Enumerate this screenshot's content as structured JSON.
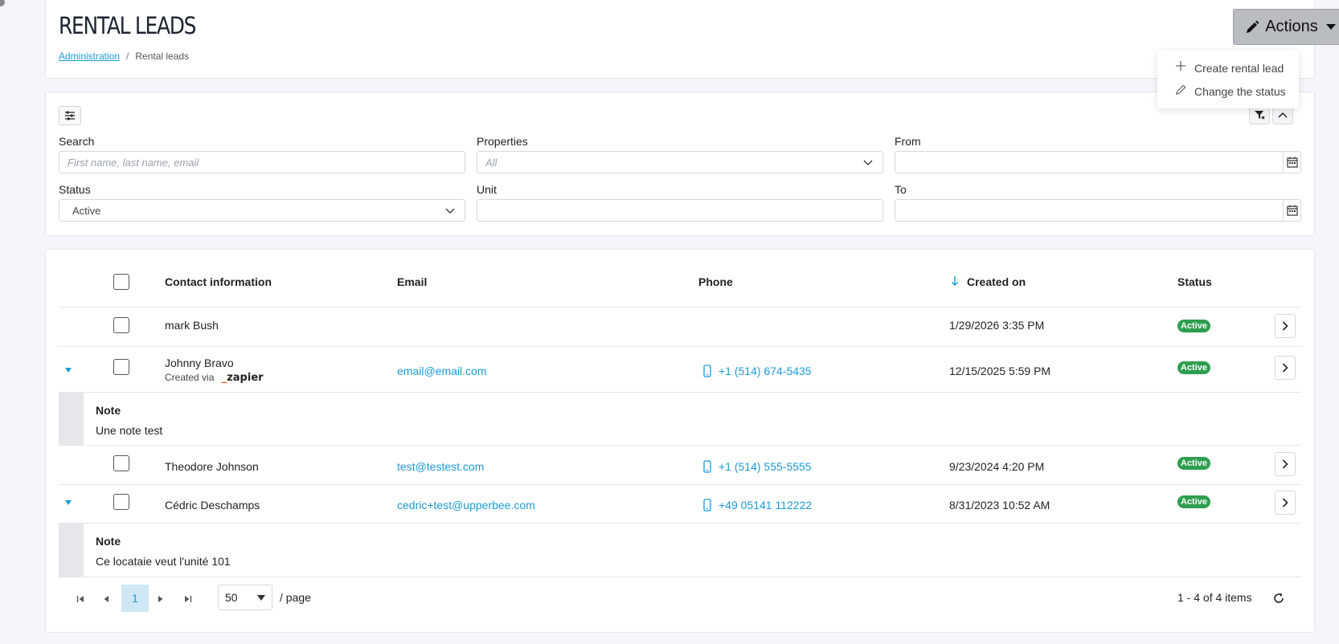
{
  "header": {
    "title": "RENTAL LEADS",
    "breadcrumb": {
      "root": "Administration",
      "separator": "/",
      "current": "Rental leads"
    },
    "actions_label": "Actions",
    "actions_menu": [
      {
        "icon": "plus-icon",
        "label": "Create rental lead"
      },
      {
        "icon": "pencil-icon",
        "label": "Change the status"
      }
    ]
  },
  "filters": {
    "search": {
      "label": "Search",
      "placeholder": "First name, last name, email"
    },
    "properties": {
      "label": "Properties",
      "value": "All"
    },
    "from": {
      "label": "From",
      "value": ""
    },
    "status": {
      "label": "Status",
      "value": "Active"
    },
    "unit": {
      "label": "Unit",
      "value": ""
    },
    "to": {
      "label": "To",
      "value": ""
    }
  },
  "table": {
    "columns": {
      "contact": "Contact information",
      "email": "Email",
      "phone": "Phone",
      "created": "Created on",
      "status": "Status"
    },
    "rows": [
      {
        "name": "mark Bush",
        "email": "",
        "phone": "",
        "created": "1/29/2026 3:35 PM",
        "status": "Active"
      },
      {
        "name": "Johnny Bravo",
        "created_via": "Created via",
        "source_logo": "zapier",
        "email": "email@email.com",
        "phone": "+1 (514) 674-5435",
        "created": "12/15/2025 5:59 PM",
        "status": "Active",
        "note": {
          "title": "Note",
          "text": "Une note test"
        }
      },
      {
        "name": "Theodore Johnson",
        "email": "test@testest.com",
        "phone": "+1 (514) 555-5555",
        "created": "9/23/2024 4:20 PM",
        "status": "Active"
      },
      {
        "name": "Cédric Deschamps",
        "email": "cedric+test@upperbee.com",
        "phone": "+49 05141 112222",
        "created": "8/31/2023 10:52 AM",
        "status": "Active",
        "note": {
          "title": "Note",
          "text": "Ce locataie veut l'unité 101"
        }
      }
    ]
  },
  "pagination": {
    "current_page": "1",
    "page_size": "50",
    "per_page_label": "/ page",
    "summary": "1 - 4 of 4 items"
  },
  "colors": {
    "accent": "#1a9bd7",
    "status_active": "#2e9e4f",
    "page_bg": "#f4f6f9"
  }
}
